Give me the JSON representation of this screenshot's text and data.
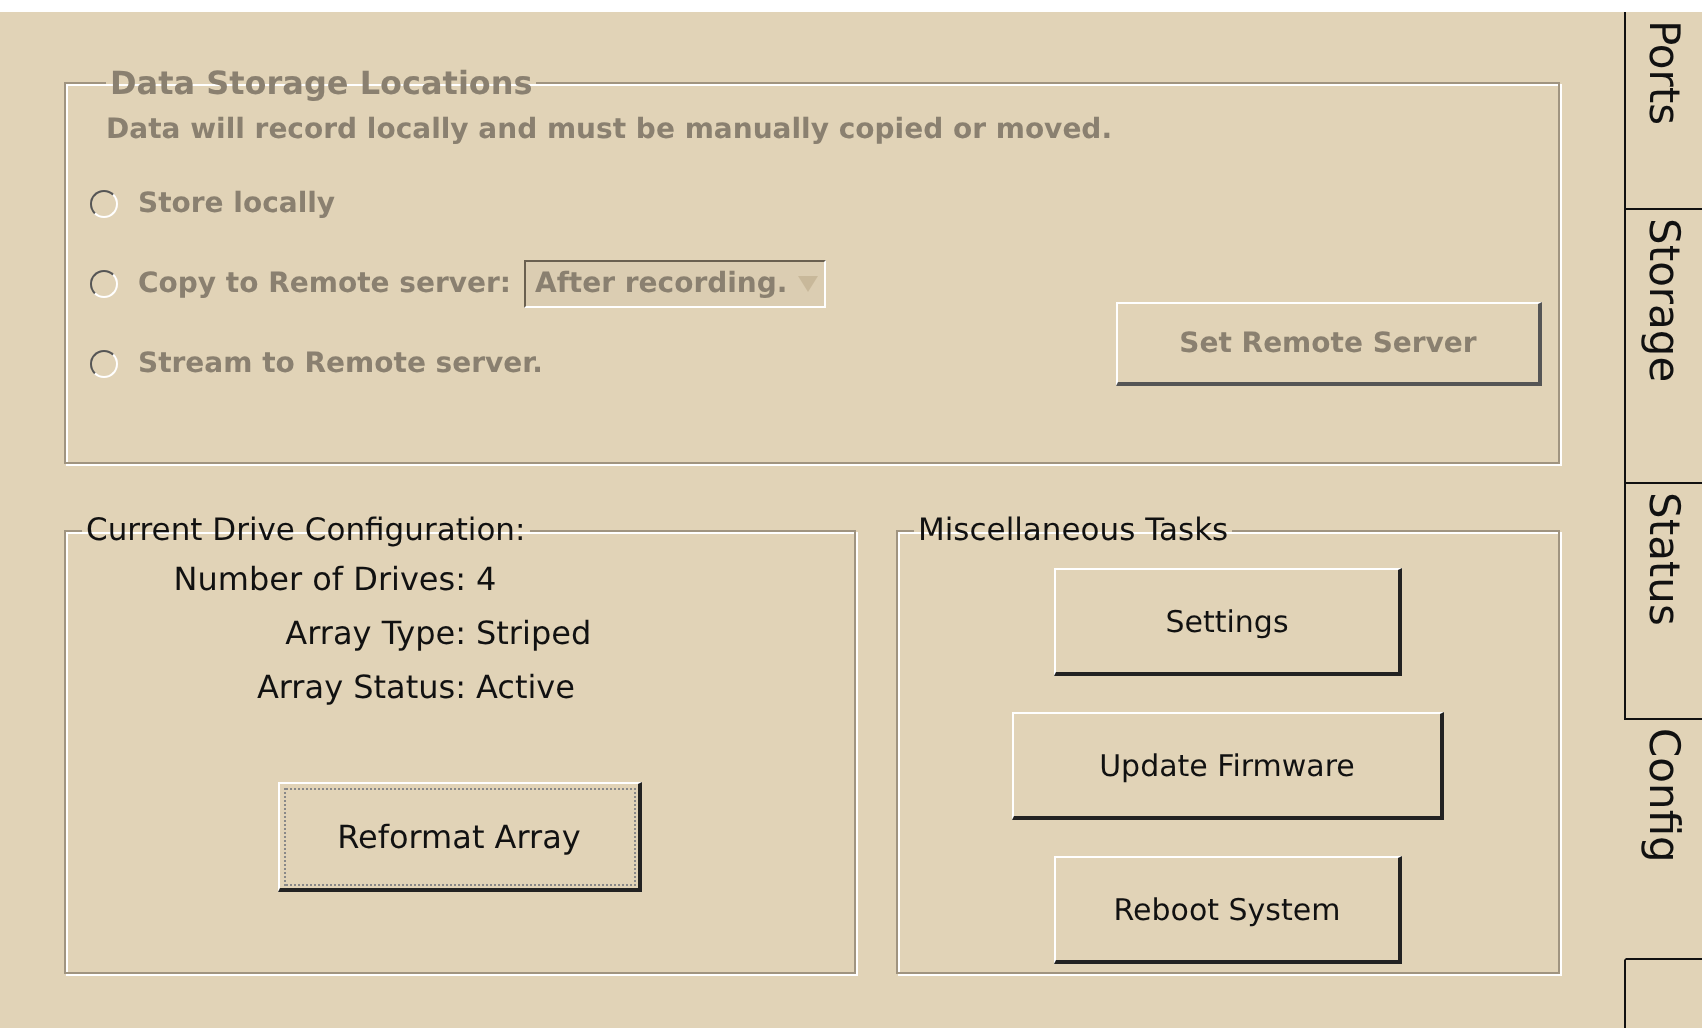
{
  "storage": {
    "title": "Data Storage Locations",
    "disabled": true,
    "note": "Data will record locally and must be manually copied or moved.",
    "options": [
      {
        "label": "Store locally",
        "selected": false
      },
      {
        "label": "Copy to Remote server:",
        "selected": false,
        "dropdown": "After recording."
      },
      {
        "label": "Stream to Remote server.",
        "selected": false
      }
    ],
    "button": "Set Remote Server"
  },
  "drive": {
    "title": "Current Drive Configuration:",
    "rows": [
      {
        "label": "Number of Drives:",
        "value": "4"
      },
      {
        "label": "Array Type:",
        "value": "Striped"
      },
      {
        "label": "Array Status:",
        "value": "Active"
      }
    ],
    "button": "Reformat Array"
  },
  "misc": {
    "title": "Miscellaneous Tasks",
    "buttons": [
      "Settings",
      "Update Firmware",
      "Reboot System"
    ]
  },
  "tabs": [
    {
      "label": "Ports",
      "selected": false
    },
    {
      "label": "Storage",
      "selected": false
    },
    {
      "label": "Status",
      "selected": false
    },
    {
      "label": "Config",
      "selected": true
    }
  ]
}
